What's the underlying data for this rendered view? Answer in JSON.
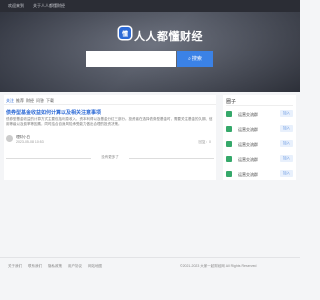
{
  "topbar": {
    "login": "欢迎来到",
    "about": "关于人人都懂财经"
  },
  "hero": {
    "logo_glyph": "懂",
    "brand": "人人都懂财经"
  },
  "search": {
    "placeholder": "",
    "button": "搜索"
  },
  "tabs": [
    {
      "label": "关注"
    },
    {
      "label": "推荐"
    },
    {
      "label": "财经"
    },
    {
      "label": "问答"
    },
    {
      "label": "下载"
    }
  ],
  "post": {
    "title": "债券型基金收益如何计算以及相关注意事项",
    "body": "债券型基金收益的计算方式主要包括利息收入、资本利得以及基金分红三部分。投资者在选择债券型基金时，需要关注基金的久期、信用等级以及费率等因素，同时结合自身风险承受能力做出合理的投资决策。",
    "author": "理财小白",
    "time": "2023-05-08 10:53",
    "replies": "回复：0"
  },
  "divider": "没有更多了",
  "sidebar": {
    "title": "圈子",
    "items": [
      {
        "label": "运营交流群",
        "join": "加入"
      },
      {
        "label": "运营交流群",
        "join": "加入"
      },
      {
        "label": "运营交流群",
        "join": "加入"
      },
      {
        "label": "运营交流群",
        "join": "加入"
      },
      {
        "label": "运营交流群",
        "join": "加入"
      }
    ]
  },
  "footer": {
    "links": [
      "关于我们",
      "联系我们",
      "隐私政策",
      "用户协议",
      "网站地图"
    ],
    "copyright": "©2021-2023 大家一起财经网 All Rights Reserved"
  },
  "colors": {
    "accent": "#2e6bd6",
    "button": "#3b82e6",
    "green_icon": "#35a86a",
    "topbar": "#2b2d35"
  }
}
